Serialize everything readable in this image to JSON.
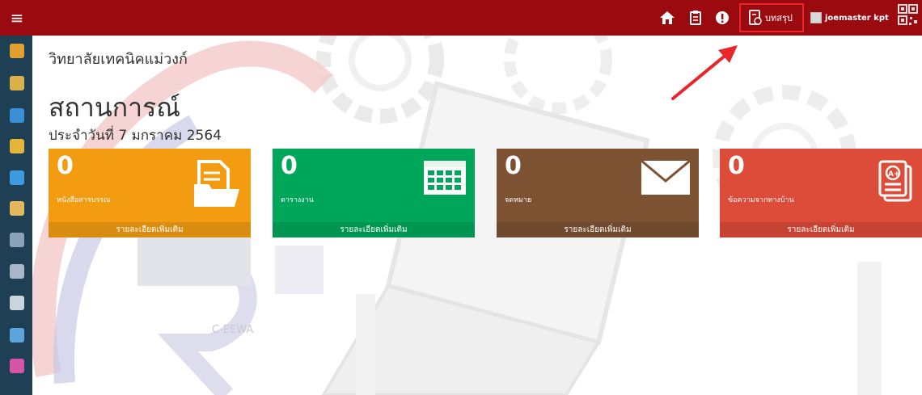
{
  "topbar": {
    "summary_label": "บทสรุป",
    "user_name": "joemaster kpt"
  },
  "header": {
    "school_name": "วิทยาลัยเทคนิคแม่วงก์",
    "title": "สถานการณ์",
    "subtitle": "ประจำวันที่ 7 มกราคม 2564"
  },
  "cards": [
    {
      "count": "0",
      "label": "หนังสือสารบรรณ",
      "footer": "รายละเอียดเพิ่มเติม",
      "icon": "document-folder-icon",
      "color": "#f39c12"
    },
    {
      "count": "0",
      "label": "ตารางงาน",
      "footer": "รายละเอียดเพิ่มเติม",
      "icon": "calendar-grid-icon",
      "color": "#00a65a"
    },
    {
      "count": "0",
      "label": "จดหมาย",
      "footer": "รายละเอียดเพิ่มเติม",
      "icon": "envelope-icon",
      "color": "#7d5233"
    },
    {
      "count": "0",
      "label": "ข้อความจากทางบ้าน",
      "footer": "รายละเอียดเพิ่มเติม",
      "icon": "grade-report-icon",
      "color": "#dd4b39"
    }
  ],
  "watermark": {
    "logo_text": "C-EEWA"
  },
  "colors": {
    "topbar": "#9b0a0f",
    "sidebar": "#1f3f55",
    "highlight_border": "#e8262c"
  }
}
